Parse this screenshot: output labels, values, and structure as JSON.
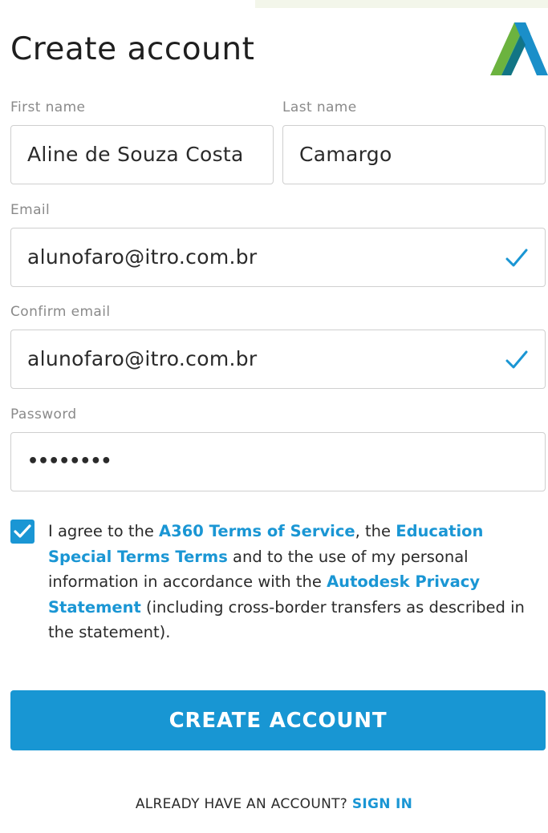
{
  "page": {
    "title": "Create account",
    "logo": {
      "icon": "autodesk-logo-icon"
    }
  },
  "form": {
    "first_name": {
      "label": "First name",
      "value": "Aline de Souza Costa"
    },
    "last_name": {
      "label": "Last name",
      "value": "Camargo"
    },
    "email": {
      "label": "Email",
      "value": "alunofaro@itro.com.br",
      "valid_icon": "checkmark-icon"
    },
    "confirm_email": {
      "label": "Confirm email",
      "value": "alunofaro@itro.com.br",
      "valid_icon": "checkmark-icon"
    },
    "password": {
      "label": "Password",
      "masked_value": "••••••••"
    }
  },
  "agreement": {
    "checked": true,
    "text_1": "I agree to the ",
    "link_terms": "A360 Terms of Service",
    "text_2": ", the ",
    "link_education": "Education Special Terms Terms",
    "text_3": " and to the use of my personal information in accordance with the ",
    "link_privacy": "Autodesk Privacy Statement",
    "text_4": " (including cross-border transfers as described in the statement)."
  },
  "actions": {
    "create_label": "CREATE ACCOUNT",
    "signin_prompt": "ALREADY HAVE AN ACCOUNT? ",
    "signin_link": "SIGN IN"
  },
  "colors": {
    "accent": "#1896d3",
    "label": "#8a8a8a",
    "border": "#cfcfcf"
  }
}
